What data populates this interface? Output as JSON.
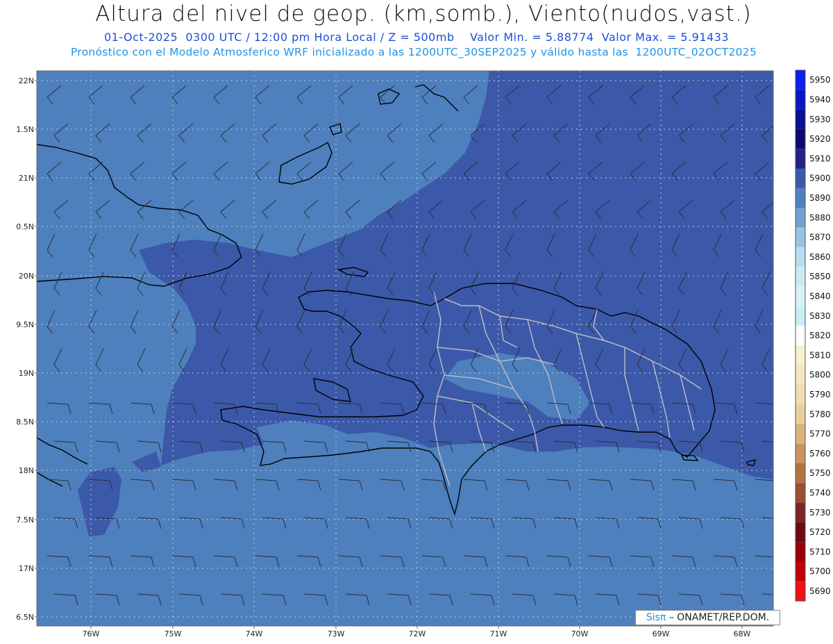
{
  "header": {
    "title": "Altura del nivel de geop. (km,somb.), Viento(nudos,vast.)",
    "subtitle_line1": "01-Oct-2025  0300 UTC / 12:00 pm Hora Local / Z = 500mb    Valor Min. = 5.88774  Valor Max. = 5.91433",
    "subtitle_line2": "Pronóstico con el Modelo Atmosferico WRF inicializado a las 1200UTC_30SEP2025 y válido hasta las  1200UTC_02OCT2025"
  },
  "map": {
    "latitude_labels": [
      "22N",
      "1.5N",
      "21N",
      "0.5N",
      "20N",
      "9.5N",
      "19N",
      "8.5N",
      "18N",
      "7.5N",
      "17N",
      "6.5N"
    ],
    "longitude_labels": [
      "76W",
      "75W",
      "74W",
      "73W",
      "72W",
      "71W",
      "70W",
      "69W",
      "68W"
    ],
    "fill_colors": {
      "level_5890": "#4d80bd",
      "level_5900": "#3c58a8"
    }
  },
  "colorbar": {
    "levels": [
      {
        "label": "5950",
        "color": "#0a1ff2"
      },
      {
        "label": "5940",
        "color": "#0a14c8"
      },
      {
        "label": "5930",
        "color": "#0a0f96"
      },
      {
        "label": "5920",
        "color": "#0c0a6e"
      },
      {
        "label": "5910",
        "color": "#222188"
      },
      {
        "label": "5900",
        "color": "#3c58a8"
      },
      {
        "label": "5890",
        "color": "#4d80bd"
      },
      {
        "label": "5880",
        "color": "#6ea1cf"
      },
      {
        "label": "5870",
        "color": "#96c4e1"
      },
      {
        "label": "5860",
        "color": "#b8dfee"
      },
      {
        "label": "5850",
        "color": "#cbeaf4"
      },
      {
        "label": "5840",
        "color": "#d9f0f8"
      },
      {
        "label": "5830",
        "color": "#c6eff6"
      },
      {
        "label": "5820",
        "color": "#ffffff"
      },
      {
        "label": "5810",
        "color": "#f9f0cf"
      },
      {
        "label": "5800",
        "color": "#f4e6bd"
      },
      {
        "label": "5790",
        "color": "#eeddb0"
      },
      {
        "label": "5780",
        "color": "#e8cf9b"
      },
      {
        "label": "5770",
        "color": "#d9b47c"
      },
      {
        "label": "5760",
        "color": "#c99460"
      },
      {
        "label": "5750",
        "color": "#b3733f"
      },
      {
        "label": "5740",
        "color": "#9b4f32"
      },
      {
        "label": "5730",
        "color": "#7d2625"
      },
      {
        "label": "5720",
        "color": "#6b0a14"
      },
      {
        "label": "5710",
        "color": "#980007"
      },
      {
        "label": "5700",
        "color": "#c20006"
      },
      {
        "label": "5690",
        "color": "#ee1111"
      }
    ]
  },
  "credit": {
    "brand": "Sisπ",
    "text": "– ONAMET/REP.DOM."
  }
}
